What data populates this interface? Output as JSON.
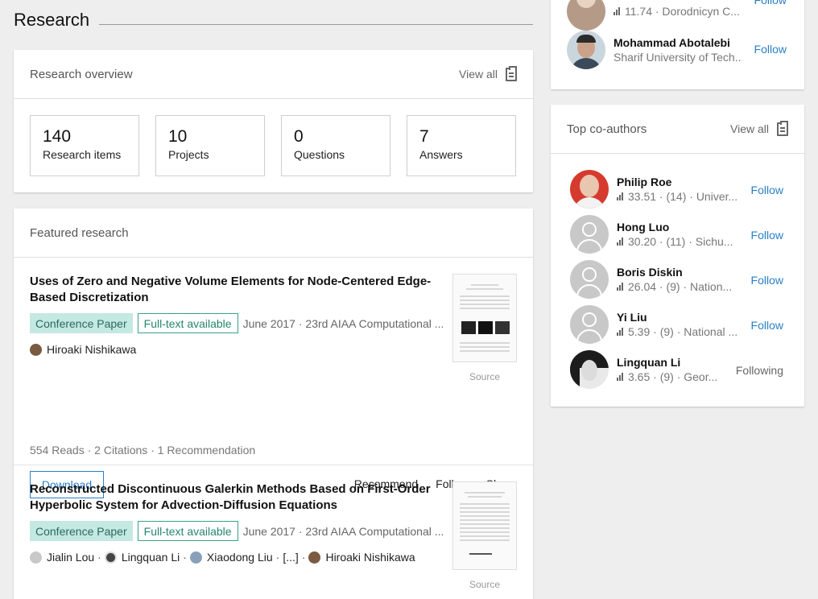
{
  "section": {
    "title": "Research"
  },
  "overview": {
    "title": "Research overview",
    "view_all": "View all",
    "stats": [
      {
        "num": "140",
        "label": "Research items"
      },
      {
        "num": "10",
        "label": "Projects"
      },
      {
        "num": "0",
        "label": "Questions"
      },
      {
        "num": "7",
        "label": "Answers"
      }
    ]
  },
  "featured": {
    "title": "Featured research",
    "items": [
      {
        "title": "Uses of Zero and Negative Volume Elements for Node-Centered Edge-Based Discretization",
        "type": "Conference Paper",
        "fulltext": "Full-text available",
        "meta": "June 2017 · 23rd AIAA Computational ...",
        "authors": [
          "Hiroaki Nishikawa"
        ],
        "source": "Source",
        "stats": "554 Reads · 2 Citations · 1 Recommendation",
        "download": "Download",
        "actions": {
          "recommend": "Recommend",
          "follow": "Follow",
          "share": "Share"
        }
      },
      {
        "title": "Reconstructed Discontinuous Galerkin Methods Based on First-Order Hyperbolic System for Advection-Diffusion Equations",
        "type": "Conference Paper",
        "fulltext": "Full-text available",
        "meta": "June 2017 · 23rd AIAA Computational ...",
        "authors": [
          "Jialin Lou",
          "Lingquan Li",
          "Xiaodong Liu",
          "[...]",
          "Hiroaki Nishikawa"
        ],
        "source": "Source"
      }
    ]
  },
  "people_to_follow": [
    {
      "name": "",
      "sub": "11.74 · Dorodnicyn C...",
      "action": "Follow"
    },
    {
      "name": "Mohammad Abotalebi",
      "sub": "Sharif University of Tech...",
      "action": "Follow"
    }
  ],
  "coauthors": {
    "title": "Top co-authors",
    "view_all": "View all",
    "people": [
      {
        "name": "Philip Roe",
        "sub": "33.51 · (14) · Univer...",
        "action": "Follow"
      },
      {
        "name": "Hong Luo",
        "sub": "30.20 · (11) · Sichu...",
        "action": "Follow"
      },
      {
        "name": "Boris Diskin",
        "sub": "26.04 · (9) · Nation...",
        "action": "Follow"
      },
      {
        "name": "Yi Liu",
        "sub": "5.39 · (9) · National ...",
        "action": "Follow"
      },
      {
        "name": "Lingquan Li",
        "sub": "3.65 · (9) · Geor...",
        "action": "Following"
      }
    ]
  },
  "colors": {
    "link": "#2a7fc6",
    "badge_bg": "#c4e8e2",
    "badge_border": "#3aa08d"
  }
}
